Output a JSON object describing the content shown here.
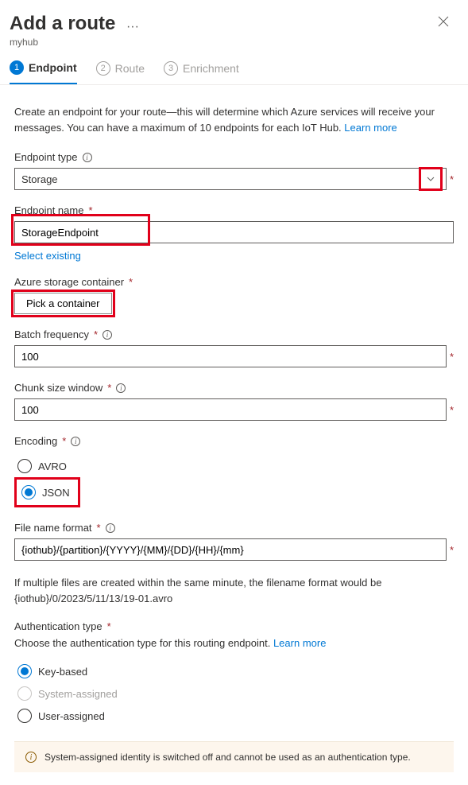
{
  "header": {
    "title": "Add a route",
    "subtitle": "myhub"
  },
  "steps": [
    {
      "num": "1",
      "label": "Endpoint",
      "active": true
    },
    {
      "num": "2",
      "label": "Route",
      "active": false
    },
    {
      "num": "3",
      "label": "Enrichment",
      "active": false
    }
  ],
  "intro": {
    "text_a": "Create an endpoint for your route—this will determine which Azure services will receive your messages. You can have a maximum of 10 endpoints for each IoT Hub. ",
    "learn_more": "Learn more"
  },
  "endpoint_type": {
    "label": "Endpoint type",
    "value": "Storage"
  },
  "endpoint_name": {
    "label": "Endpoint name",
    "value": "StorageEndpoint",
    "select_existing": "Select existing"
  },
  "storage_container": {
    "label": "Azure storage container",
    "button": "Pick a container"
  },
  "batch_frequency": {
    "label": "Batch frequency",
    "value": "100"
  },
  "chunk_size": {
    "label": "Chunk size window",
    "value": "100"
  },
  "encoding": {
    "label": "Encoding",
    "options": {
      "avro": "AVRO",
      "json": "JSON"
    },
    "selected": "json"
  },
  "filename_format": {
    "label": "File name format",
    "value": "{iothub}/{partition}/{YYYY}/{MM}/{DD}/{HH}/{mm}"
  },
  "note": "If multiple files are created within the same minute, the filename format would be {iothub}/0/2023/5/11/13/19-01.avro",
  "auth_type": {
    "label": "Authentication type",
    "desc": "Choose the authentication type for this routing endpoint. ",
    "learn_more": "Learn more",
    "options": {
      "key": "Key-based",
      "system": "System-assigned",
      "user": "User-assigned"
    },
    "selected": "key"
  },
  "banner": "System-assigned identity is switched off and cannot be used as an authentication type."
}
